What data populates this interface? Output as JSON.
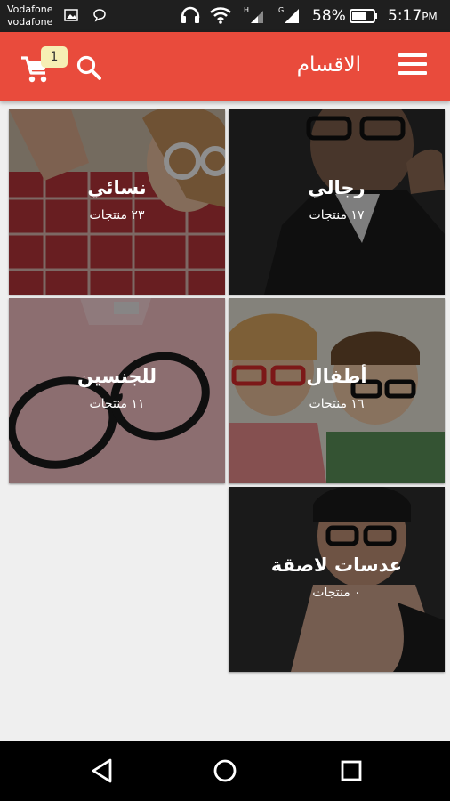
{
  "status_bar": {
    "carrier_line1": "Vodafone",
    "carrier_line2": "vodafone",
    "battery_percent": "58%",
    "time": "5:17",
    "time_suffix": "PM",
    "icons": [
      "image-icon",
      "chat-icon",
      "headset-icon",
      "wifi-icon",
      "signal-h-icon",
      "signal-icon",
      "battery-icon"
    ]
  },
  "app_bar": {
    "title": "الاقسام",
    "cart_count": "1",
    "background_color": "#e94b3c",
    "icons": [
      "menu-icon",
      "search-icon",
      "cart-icon"
    ]
  },
  "categories": [
    {
      "name": "رجالي",
      "count": "١٧ منتجات"
    },
    {
      "name": "نسائي",
      "count": "٢٣ منتجات"
    },
    {
      "name": "أطفال",
      "count": "١٦ منتجات"
    },
    {
      "name": "للجنسين",
      "count": "١١ منتجات"
    },
    {
      "name": "عدسات لاصقة",
      "count": "٠ منتجات"
    }
  ],
  "nav_bar": {
    "icons": [
      "back-icon",
      "home-icon",
      "recents-icon"
    ]
  }
}
